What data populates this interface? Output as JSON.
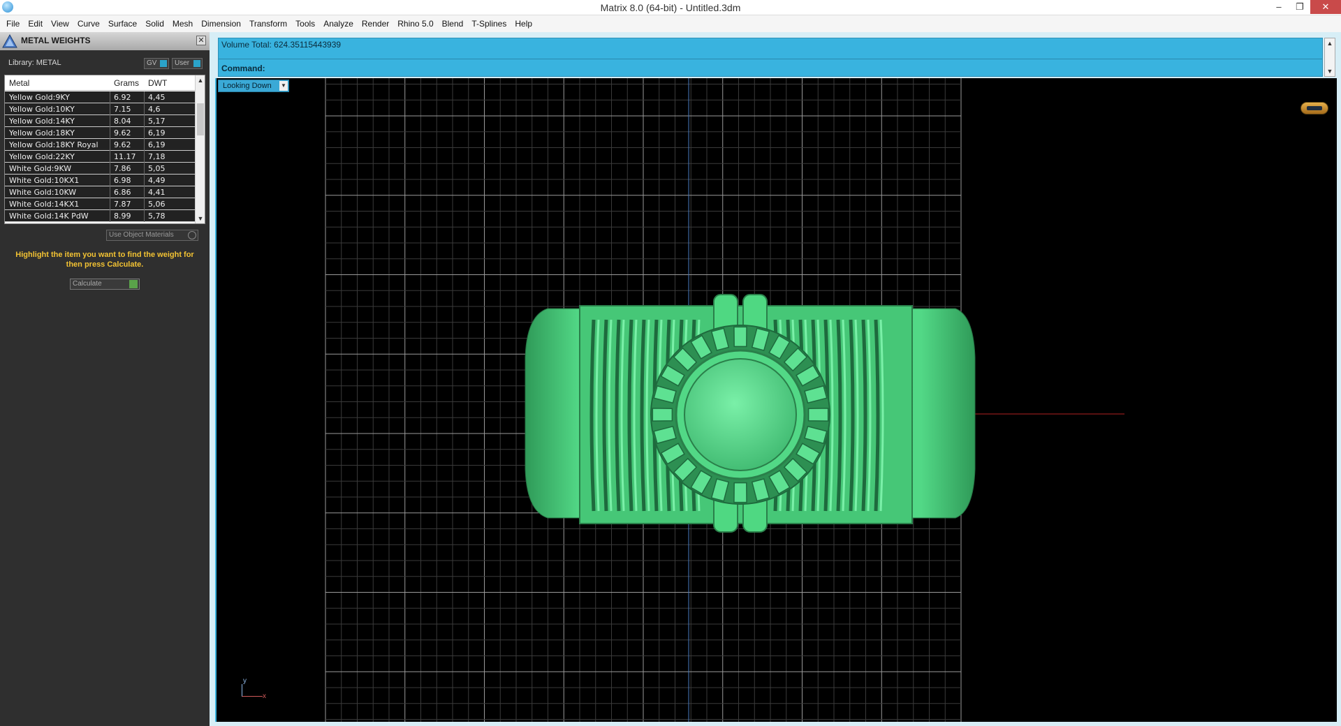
{
  "window": {
    "title": "Matrix 8.0 (64-bit) - Untitled.3dm",
    "controls": {
      "minimize": "–",
      "restore": "❐",
      "close": "✕"
    }
  },
  "menubar": {
    "items": [
      "File",
      "Edit",
      "View",
      "Curve",
      "Surface",
      "Solid",
      "Mesh",
      "Dimension",
      "Transform",
      "Tools",
      "Analyze",
      "Render",
      "Rhino 5.0",
      "Blend",
      "T-Splines",
      "Help"
    ]
  },
  "panel": {
    "title": "METAL WEIGHTS",
    "close_label": "✕",
    "library_label": "Library: METAL",
    "toggles": {
      "gv": "GV",
      "user": "User"
    },
    "table": {
      "headers": {
        "metal": "Metal",
        "grams": "Grams",
        "dwt": "DWT"
      },
      "rows": [
        {
          "metal": "Yellow Gold:9KY",
          "grams": "6.92",
          "dwt": "4,45"
        },
        {
          "metal": "Yellow Gold:10KY",
          "grams": "7.15",
          "dwt": "4,6"
        },
        {
          "metal": "Yellow Gold:14KY",
          "grams": "8.04",
          "dwt": "5,17"
        },
        {
          "metal": "Yellow Gold:18KY",
          "grams": "9.62",
          "dwt": "6,19"
        },
        {
          "metal": "Yellow Gold:18KY Royal",
          "grams": "9.62",
          "dwt": "6,19"
        },
        {
          "metal": "Yellow Gold:22KY",
          "grams": "11.17",
          "dwt": "7,18"
        },
        {
          "metal": "White Gold:9KW",
          "grams": "7.86",
          "dwt": "5,05"
        },
        {
          "metal": "White Gold:10KX1",
          "grams": "6.98",
          "dwt": "4,49"
        },
        {
          "metal": "White Gold:10KW",
          "grams": "6.86",
          "dwt": "4,41"
        },
        {
          "metal": "White Gold:14KX1",
          "grams": "7.87",
          "dwt": "5,06"
        },
        {
          "metal": "White Gold:14K PdW",
          "grams": "8.99",
          "dwt": "5,78"
        }
      ],
      "scroll_up": "▲",
      "scroll_down": "▼"
    },
    "use_object_materials": "Use Object Materials",
    "hint": "Highlight the item you want to find the weight for then press Calculate.",
    "calculate_label": "Calculate"
  },
  "command": {
    "history": "Volume Total: 624.35115443939",
    "prompt_label": "Command:",
    "scroll_up": "▲",
    "scroll_down": "▼"
  },
  "viewport": {
    "view_name": "Looking Down",
    "dropdown_glyph": "▼",
    "axis_y": "y",
    "axis_x": "x",
    "colors": {
      "background": "#000000",
      "grid_minor": "#3a3a3a",
      "grid_major": "#9a9a9a",
      "model": "#4fd882",
      "x_axis": "#b22222",
      "y_axis": "#4a7bbf",
      "accent": "#39b3df"
    },
    "nav_icon": "navigation-cube-icon"
  }
}
